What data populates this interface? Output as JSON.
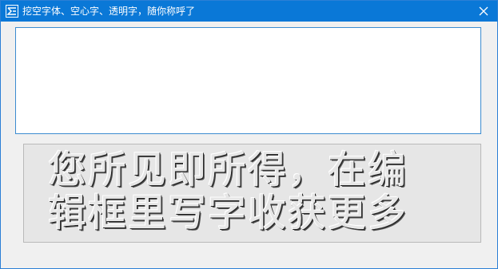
{
  "window": {
    "title": "挖空字体、空心字、透明字，随你称呼了",
    "icon": "app-icon",
    "close_icon": "close-icon"
  },
  "editor": {
    "value": ""
  },
  "preview": {
    "line1": "您所见即所得，在编",
    "line2": "辑框里写字收获更多"
  },
  "colors": {
    "titlebar": "#0a78d7",
    "client_bg": "#f0f0f0",
    "edit_border": "#3c8cd0",
    "preview_bg": "#e6e6e6"
  }
}
